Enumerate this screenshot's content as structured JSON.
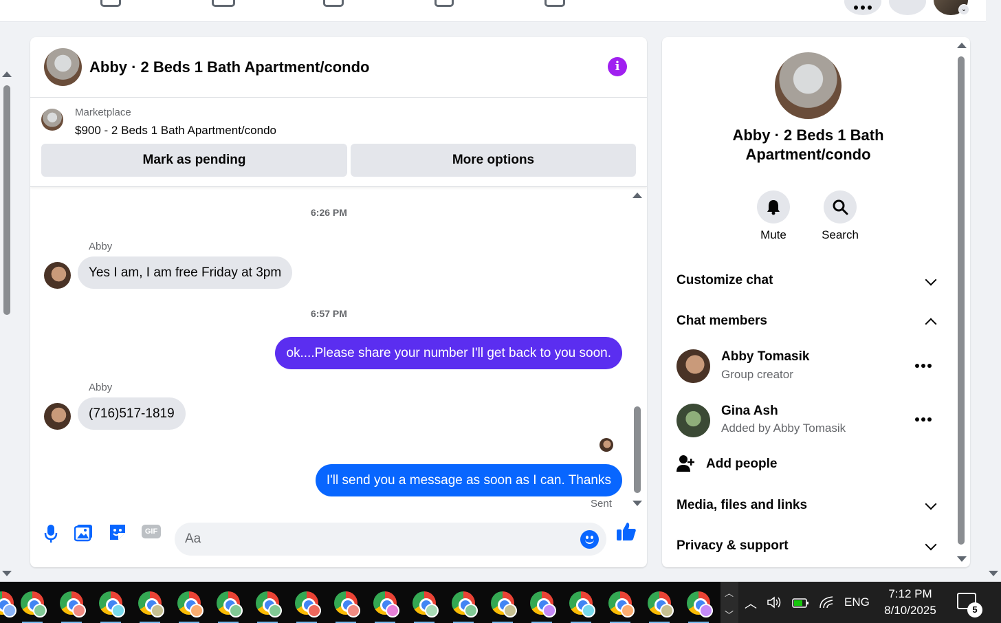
{
  "chat": {
    "title": "Abby · 2 Beds 1 Bath Apartment/condo",
    "marketplace_label": "Marketplace",
    "listing": "$900 - 2 Beds 1 Bath Apartment/condo",
    "mark_pending": "Mark as pending",
    "more_options": "More options",
    "messages": [
      {
        "timestamp": "6:26 PM"
      },
      {
        "sender": "Abby",
        "text": "Yes I am, I am free Friday at 3pm"
      },
      {
        "timestamp": "6:57 PM"
      },
      {
        "outgoing": true,
        "text": "ok....Please share your number I'll get back to you soon.",
        "color": "#5b2ef0"
      },
      {
        "sender": "Abby",
        "text": "(716)517-1819"
      },
      {
        "outgoing": true,
        "text": "I'll send you a message as soon as I can. Thanks",
        "color": "#0866ff"
      }
    ],
    "sent_label": "Sent",
    "composer_placeholder": "Aa"
  },
  "panel": {
    "title": "Abby · 2 Beds 1 Bath Apartment/condo",
    "mute_label": "Mute",
    "search_label": "Search",
    "customize_chat": "Customize chat",
    "chat_members": "Chat members",
    "members": [
      {
        "name": "Abby Tomasik",
        "role": "Group creator"
      },
      {
        "name": "Gina Ash",
        "role": "Added by Abby Tomasik"
      }
    ],
    "add_people": "Add people",
    "media_files_links": "Media, files and links",
    "privacy_support": "Privacy & support"
  },
  "taskbar": {
    "language": "ENG",
    "time": "7:12 PM",
    "date": "8/10/2025",
    "notification_count": "5"
  },
  "colors": {
    "accent": "#0866ff",
    "info": "#a020f0",
    "outgoing_purple": "#5b2ef0"
  }
}
